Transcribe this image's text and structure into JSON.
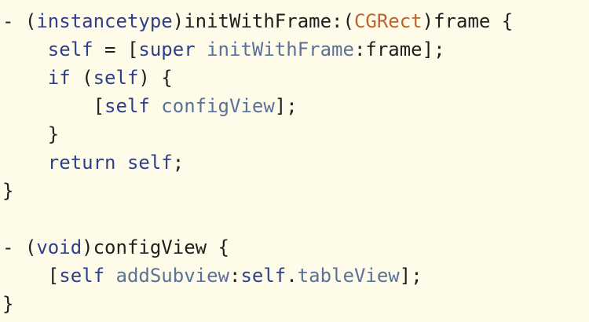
{
  "editor": {
    "background": "#fffbe9",
    "colors": {
      "plain": "#1f1f1f",
      "keyword": "#2f3f8a",
      "method": "#5a7299",
      "type": "#c0622d"
    },
    "lines": [
      [
        {
          "text": "- (",
          "role": "plain"
        },
        {
          "text": "instancetype",
          "role": "keyword"
        },
        {
          "text": ")initWithFrame:(",
          "role": "plain"
        },
        {
          "text": "CGRect",
          "role": "type"
        },
        {
          "text": ")frame {",
          "role": "plain"
        }
      ],
      [
        {
          "text": "    ",
          "role": "plain"
        },
        {
          "text": "self",
          "role": "keyword"
        },
        {
          "text": " = [",
          "role": "plain"
        },
        {
          "text": "super",
          "role": "keyword"
        },
        {
          "text": " ",
          "role": "plain"
        },
        {
          "text": "initWithFrame",
          "role": "method"
        },
        {
          "text": ":frame];",
          "role": "plain"
        }
      ],
      [
        {
          "text": "    ",
          "role": "plain"
        },
        {
          "text": "if",
          "role": "keyword"
        },
        {
          "text": " (",
          "role": "plain"
        },
        {
          "text": "self",
          "role": "keyword"
        },
        {
          "text": ") {",
          "role": "plain"
        }
      ],
      [
        {
          "text": "        [",
          "role": "plain"
        },
        {
          "text": "self",
          "role": "keyword"
        },
        {
          "text": " ",
          "role": "plain"
        },
        {
          "text": "configView",
          "role": "method"
        },
        {
          "text": "];",
          "role": "plain"
        }
      ],
      [
        {
          "text": "    }",
          "role": "plain"
        }
      ],
      [
        {
          "text": "    ",
          "role": "plain"
        },
        {
          "text": "return",
          "role": "keyword"
        },
        {
          "text": " ",
          "role": "plain"
        },
        {
          "text": "self",
          "role": "keyword"
        },
        {
          "text": ";",
          "role": "plain"
        }
      ],
      [
        {
          "text": "}",
          "role": "plain"
        }
      ],
      [],
      [
        {
          "text": "- (",
          "role": "plain"
        },
        {
          "text": "void",
          "role": "keyword"
        },
        {
          "text": ")configView {",
          "role": "plain"
        }
      ],
      [
        {
          "text": "    [",
          "role": "plain"
        },
        {
          "text": "self",
          "role": "keyword"
        },
        {
          "text": " ",
          "role": "plain"
        },
        {
          "text": "addSubview",
          "role": "method"
        },
        {
          "text": ":",
          "role": "plain"
        },
        {
          "text": "self",
          "role": "keyword"
        },
        {
          "text": ".",
          "role": "plain"
        },
        {
          "text": "tableView",
          "role": "method"
        },
        {
          "text": "];",
          "role": "plain"
        }
      ],
      [
        {
          "text": "}",
          "role": "plain"
        }
      ]
    ]
  }
}
